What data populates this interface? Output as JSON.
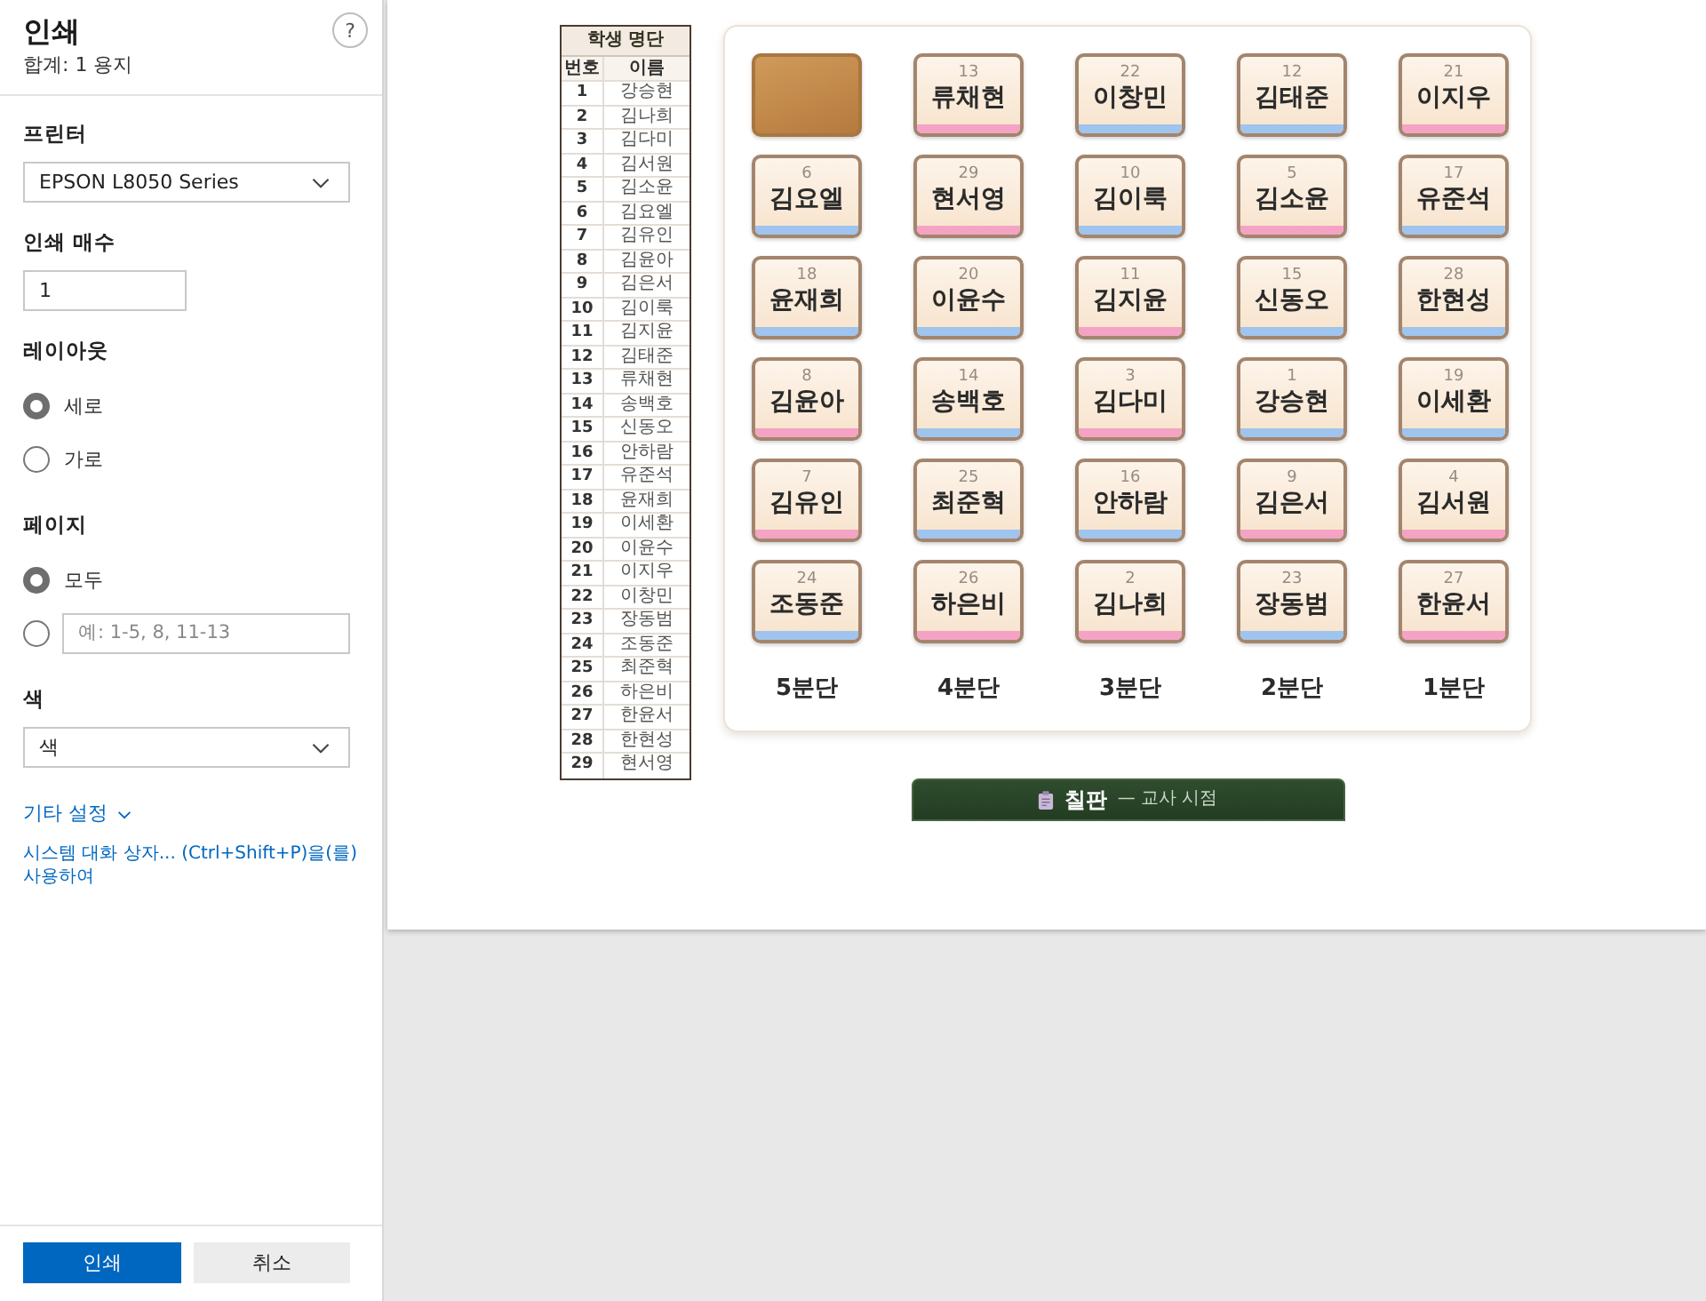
{
  "print_panel": {
    "title": "인쇄",
    "summary": "합계: 1 용지",
    "help": "?",
    "settings": [
      {
        "kind": "select",
        "label": "프린터",
        "value": "EPSON L8050 Series"
      },
      {
        "kind": "number",
        "label": "인쇄 매수",
        "value": "1"
      },
      {
        "kind": "radio",
        "label": "레이아웃",
        "options": [
          {
            "kind": "text",
            "label": "세로",
            "selected": true
          },
          {
            "kind": "text",
            "label": "가로",
            "selected": false
          }
        ]
      },
      {
        "kind": "radio",
        "label": "페이지",
        "options": [
          {
            "kind": "text",
            "label": "모두",
            "selected": true
          },
          {
            "kind": "range",
            "placeholder": "예: 1-5, 8, 11-13",
            "selected": false
          }
        ]
      },
      {
        "kind": "select",
        "label": "색",
        "value": "색"
      }
    ],
    "more_settings": {
      "label": "기타 설정",
      "expanded": false
    },
    "system_dialog_link": "시스템 대화 상자... (Ctrl+Shift+P)을(를) 사용하여",
    "buttons": [
      {
        "kind": "primary",
        "label": "인쇄"
      },
      {
        "kind": "secondary",
        "label": "취소"
      }
    ]
  },
  "preview": {
    "roster": {
      "title": "학생 명단",
      "columns": [
        "번호",
        "이름"
      ],
      "rows": [
        {
          "number": "1",
          "name": "강승현"
        },
        {
          "number": "2",
          "name": "김나희"
        },
        {
          "number": "3",
          "name": "김다미"
        },
        {
          "number": "4",
          "name": "김서원"
        },
        {
          "number": "5",
          "name": "김소윤"
        },
        {
          "number": "6",
          "name": "김요엘"
        },
        {
          "number": "7",
          "name": "김유인"
        },
        {
          "number": "8",
          "name": "김윤아"
        },
        {
          "number": "9",
          "name": "김은서"
        },
        {
          "number": "10",
          "name": "김이룩"
        },
        {
          "number": "11",
          "name": "김지윤"
        },
        {
          "number": "12",
          "name": "김태준"
        },
        {
          "number": "13",
          "name": "류채현"
        },
        {
          "number": "14",
          "name": "송백호"
        },
        {
          "number": "15",
          "name": "신동오"
        },
        {
          "number": "16",
          "name": "안하람"
        },
        {
          "number": "17",
          "name": "유준석"
        },
        {
          "number": "18",
          "name": "윤재희"
        },
        {
          "number": "19",
          "name": "이세환"
        },
        {
          "number": "20",
          "name": "이윤수"
        },
        {
          "number": "21",
          "name": "이지우"
        },
        {
          "number": "22",
          "name": "이창민"
        },
        {
          "number": "23",
          "name": "장동범"
        },
        {
          "number": "24",
          "name": "조동준"
        },
        {
          "number": "25",
          "name": "최준혁"
        },
        {
          "number": "26",
          "name": "하은비"
        },
        {
          "number": "27",
          "name": "한윤서"
        },
        {
          "number": "28",
          "name": "한현성"
        },
        {
          "number": "29",
          "name": "현서영"
        }
      ]
    },
    "seating": {
      "rows": [
        {
          "seats": [
            {
              "kind": "blank"
            },
            {
              "kind": "student",
              "number": "13",
              "name": "류채현",
              "color": "#f4a3c4"
            },
            {
              "kind": "student",
              "number": "22",
              "name": "이창민",
              "color": "#9fc4ee"
            },
            {
              "kind": "student",
              "number": "12",
              "name": "김태준",
              "color": "#9fc4ee"
            },
            {
              "kind": "student",
              "number": "21",
              "name": "이지우",
              "color": "#f4a3c4"
            }
          ]
        },
        {
          "seats": [
            {
              "kind": "student",
              "number": "6",
              "name": "김요엘",
              "color": "#9fc4ee"
            },
            {
              "kind": "student",
              "number": "29",
              "name": "현서영",
              "color": "#f4a3c4"
            },
            {
              "kind": "student",
              "number": "10",
              "name": "김이룩",
              "color": "#9fc4ee"
            },
            {
              "kind": "student",
              "number": "5",
              "name": "김소윤",
              "color": "#f4a3c4"
            },
            {
              "kind": "student",
              "number": "17",
              "name": "유준석",
              "color": "#9fc4ee"
            }
          ]
        },
        {
          "seats": [
            {
              "kind": "student",
              "number": "18",
              "name": "윤재희",
              "color": "#9fc4ee"
            },
            {
              "kind": "student",
              "number": "20",
              "name": "이윤수",
              "color": "#9fc4ee"
            },
            {
              "kind": "student",
              "number": "11",
              "name": "김지윤",
              "color": "#f4a3c4"
            },
            {
              "kind": "student",
              "number": "15",
              "name": "신동오",
              "color": "#9fc4ee"
            },
            {
              "kind": "student",
              "number": "28",
              "name": "한현성",
              "color": "#9fc4ee"
            }
          ]
        },
        {
          "seats": [
            {
              "kind": "student",
              "number": "8",
              "name": "김윤아",
              "color": "#f4a3c4"
            },
            {
              "kind": "student",
              "number": "14",
              "name": "송백호",
              "color": "#9fc4ee"
            },
            {
              "kind": "student",
              "number": "3",
              "name": "김다미",
              "color": "#f4a3c4"
            },
            {
              "kind": "student",
              "number": "1",
              "name": "강승현",
              "color": "#9fc4ee"
            },
            {
              "kind": "student",
              "number": "19",
              "name": "이세환",
              "color": "#9fc4ee"
            }
          ]
        },
        {
          "seats": [
            {
              "kind": "student",
              "number": "7",
              "name": "김유인",
              "color": "#f4a3c4"
            },
            {
              "kind": "student",
              "number": "25",
              "name": "최준혁",
              "color": "#9fc4ee"
            },
            {
              "kind": "student",
              "number": "16",
              "name": "안하람",
              "color": "#9fc4ee"
            },
            {
              "kind": "student",
              "number": "9",
              "name": "김은서",
              "color": "#f4a3c4"
            },
            {
              "kind": "student",
              "number": "4",
              "name": "김서원",
              "color": "#f4a3c4"
            }
          ]
        },
        {
          "seats": [
            {
              "kind": "student",
              "number": "24",
              "name": "조동준",
              "color": "#9fc4ee"
            },
            {
              "kind": "student",
              "number": "26",
              "name": "하은비",
              "color": "#f4a3c4"
            },
            {
              "kind": "student",
              "number": "2",
              "name": "김나희",
              "color": "#f4a3c4"
            },
            {
              "kind": "student",
              "number": "23",
              "name": "장동범",
              "color": "#9fc4ee"
            },
            {
              "kind": "student",
              "number": "27",
              "name": "한윤서",
              "color": "#f4a3c4"
            }
          ]
        }
      ],
      "groups": [
        "5분단",
        "4분단",
        "3분단",
        "2분단",
        "1분단"
      ]
    },
    "blackboard": {
      "title": "칠판",
      "subtitle": "— 교사 시점"
    }
  }
}
